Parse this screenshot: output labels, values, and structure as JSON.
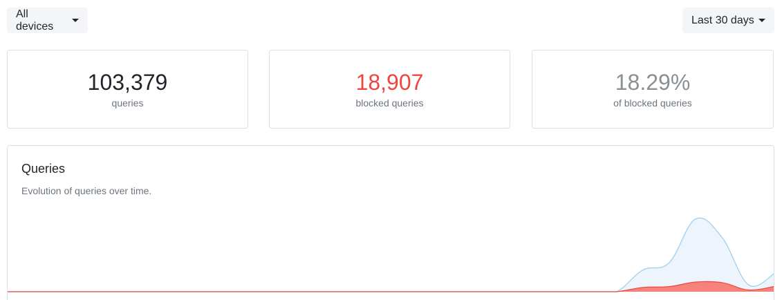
{
  "filters": {
    "devices_label": "All devices",
    "range_label": "Last 30 days"
  },
  "stats": [
    {
      "value": "103,379",
      "caption": "queries",
      "color": "#212529"
    },
    {
      "value": "18,907",
      "caption": "blocked queries",
      "color": "#f0453e"
    },
    {
      "value": "18.29%",
      "caption": "of blocked queries",
      "color": "#8a8f94"
    }
  ],
  "chart": {
    "title": "Queries",
    "subtitle": "Evolution of queries over time.",
    "colors": {
      "queries_fill": "#eef4fb",
      "queries_line": "#9ccbe8",
      "blocked_fill": "#f7827c",
      "blocked_line": "#f0453e"
    }
  },
  "chart_data": {
    "type": "area",
    "title": "Queries",
    "subtitle": "Evolution of queries over time.",
    "x": [
      1,
      2,
      3,
      4,
      5,
      6,
      7,
      8,
      9,
      10,
      11,
      12,
      13,
      14,
      15,
      16,
      17,
      18,
      19,
      20,
      21,
      22,
      23,
      24,
      25,
      26,
      27,
      28,
      29,
      30
    ],
    "series": [
      {
        "name": "queries",
        "values": [
          0,
          0,
          0,
          0,
          0,
          0,
          0,
          0,
          0,
          0,
          0,
          0,
          0,
          0,
          0,
          0,
          0,
          0,
          0,
          0,
          0,
          0,
          0,
          0,
          3800,
          5100,
          12800,
          9500,
          1200,
          3300
        ]
      },
      {
        "name": "blocked queries",
        "values": [
          0,
          0,
          0,
          0,
          0,
          0,
          0,
          0,
          0,
          0,
          0,
          0,
          0,
          0,
          0,
          0,
          0,
          0,
          0,
          0,
          0,
          0,
          0,
          0,
          750,
          900,
          1700,
          1600,
          300,
          950
        ]
      }
    ],
    "ylim": [
      0,
      13000
    ],
    "grid": false,
    "legend": "none"
  }
}
